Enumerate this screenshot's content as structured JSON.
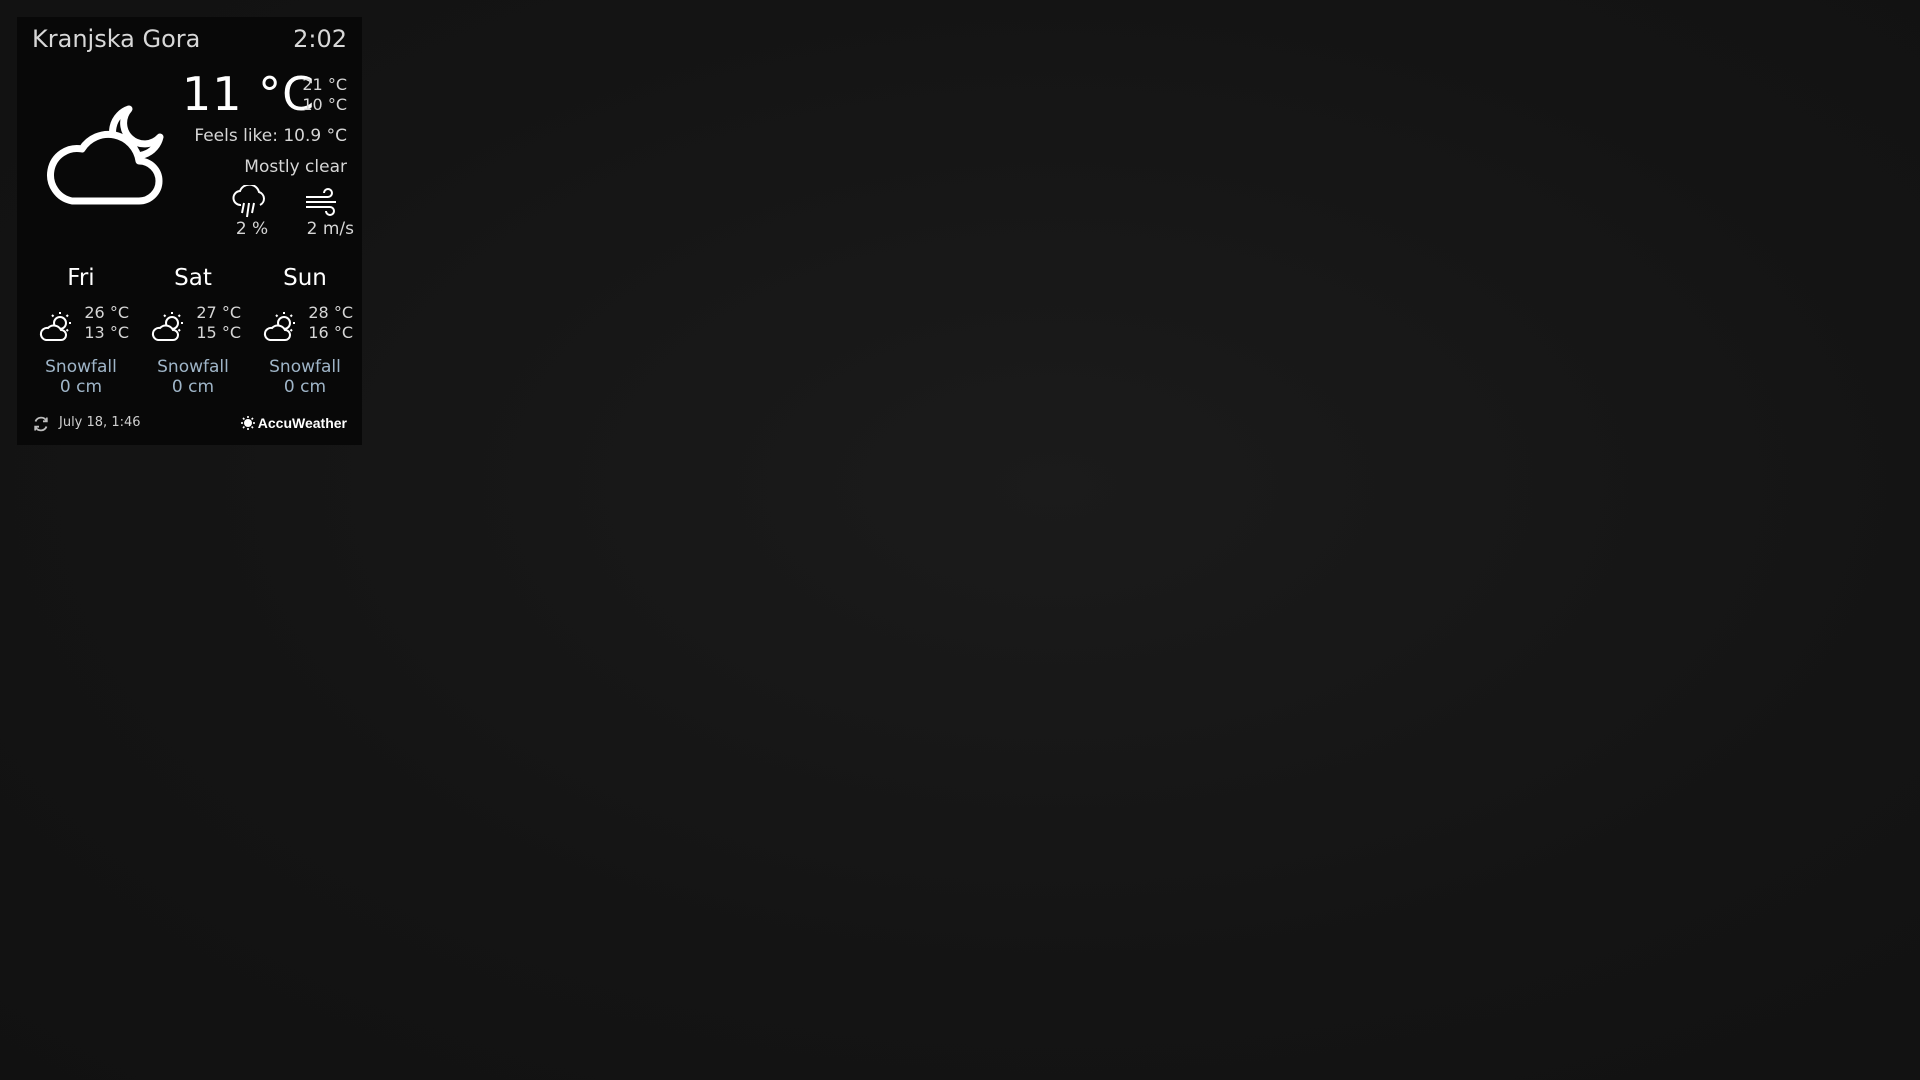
{
  "current": {
    "location": "Kranjska Gora",
    "time": "2:02",
    "temperature": "11 °C",
    "high": "21 °C",
    "low": "10 °C",
    "feels_like": "Feels like: 10.9 °C",
    "condition": "Mostly clear",
    "condition_icon": "cloud-moon-icon",
    "precipitation": "2 %",
    "wind": "2 m/s"
  },
  "forecast": [
    {
      "day": "Fri",
      "high": "26 °C",
      "low": "13 °C",
      "icon": "sun-cloud-icon",
      "label": "Snowfall",
      "snow": "0 cm"
    },
    {
      "day": "Sat",
      "high": "27 °C",
      "low": "15 °C",
      "icon": "sun-cloud-icon",
      "label": "Snowfall",
      "snow": "0 cm"
    },
    {
      "day": "Sun",
      "high": "28 °C",
      "low": "16 °C",
      "icon": "sun-cloud-icon",
      "label": "Snowfall",
      "snow": "0 cm"
    }
  ],
  "footer": {
    "updated": "July 18, 1:46",
    "brand": "AccuWeather"
  },
  "colors": {
    "background": "#151515",
    "widget": "#080808",
    "text": "#d6d6d6",
    "snow_text": "#9fb5c8"
  }
}
